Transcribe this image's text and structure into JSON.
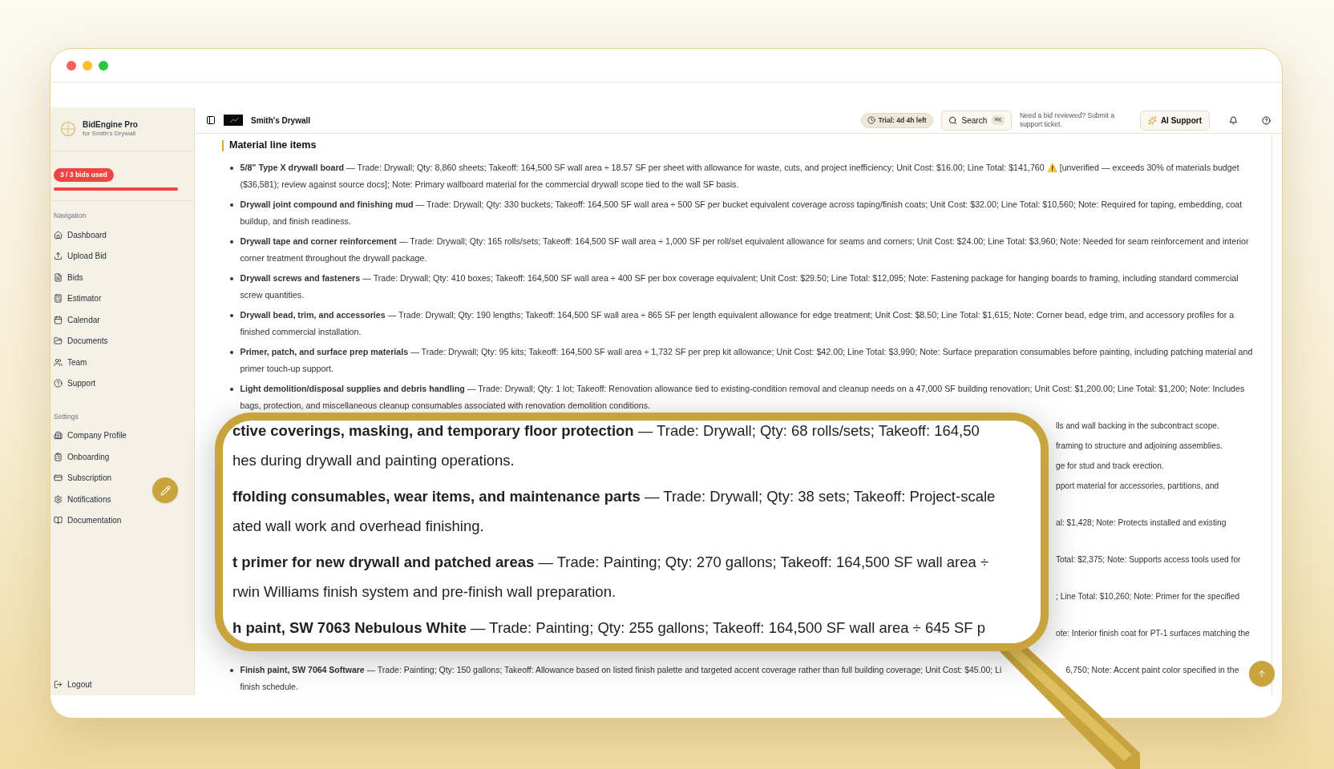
{
  "sidebar": {
    "brand": "BidEngine Pro",
    "subtitle": "for Smith's Drywall",
    "usage": {
      "badge": "3 / 3 bids used",
      "level": 1
    },
    "sections": [
      {
        "title": "Navigation",
        "items": [
          "Dashboard",
          "Upload Bid",
          "Bids",
          "Estimator",
          "Calendar",
          "Documents",
          "Team",
          "Support"
        ]
      },
      {
        "title": "Settings",
        "items": [
          "Company Profile",
          "Onboarding",
          "Subscription",
          "Notifications",
          "Documentation"
        ]
      }
    ],
    "logout": "Logout"
  },
  "header": {
    "company": "Smith's Drywall",
    "trial": "Trial: 4d 4h left",
    "search": "Search",
    "shortcut": "⌘K",
    "help_text": "Need a bid reviewed? Submit a support ticket.",
    "ai_button": "AI Support"
  },
  "section_title": "Material line items",
  "line_items": [
    "**5/8\" Type X drywall board** — Trade: Drywall; Qty: 8,860 sheets; Takeoff: 164,500 SF wall area ÷ 18.57 SF per sheet with allowance for waste, cuts, and project inefficiency; Unit Cost: $16.00; Line Total: $141,760 ⚠️ [unverified — exceeds 30% of materials budget ($36,581); review against source docs]; Note: Primary wallboard material for the commercial drywall scope tied to the wall SF basis.",
    "**Drywall joint compound and finishing mud** — Trade: Drywall; Qty: 330 buckets; Takeoff: 164,500 SF wall area ÷ 500 SF per bucket equivalent coverage across taping/finish coats; Unit Cost: $32.00; Line Total: $10,560; Note: Required for taping, embedding, coat buildup, and finish readiness.",
    "**Drywall tape and corner reinforcement** — Trade: Drywall; Qty: 165 rolls/sets; Takeoff: 164,500 SF wall area ÷ 1,000 SF per roll/set equivalent allowance for seams and corners; Unit Cost: $24.00; Line Total: $3,960; Note: Needed for seam reinforcement and interior corner treatment throughout the drywall package.",
    "**Drywall screws and fasteners** — Trade: Drywall; Qty: 410 boxes; Takeoff: 164,500 SF wall area ÷ 400 SF per box coverage equivalent; Unit Cost: $29.50; Line Total: $12,095; Note: Fastening package for hanging boards to framing, including standard commercial screw quantities.",
    "**Drywall bead, trim, and accessories** — Trade: Drywall; Qty: 190 lengths; Takeoff: 164,500 SF wall area ÷ 865 SF per length equivalent allowance for edge treatment; Unit Cost: $8.50; Line Total: $1,615; Note: Corner bead, edge trim, and accessory profiles for a finished commercial installation.",
    "**Primer, patch, and surface prep materials** — Trade: Drywall; Qty: 95 kits; Takeoff: 164,500 SF wall area ÷ 1,732 SF per prep kit allowance; Unit Cost: $42.00; Line Total: $3,990; Note: Surface preparation consumables before painting, including patching material and primer touch-up support.",
    "**Light demolition/disposal supplies and debris handling** — Trade: Drywall; Qty: 1 lot; Takeoff: Renovation allowance tied to existing-condition removal and cleanup needs on a 47,000 SF building renovation; Unit Cost: $1,200.00; Line Total: $1,200; Note: Includes bags, protection, and miscellaneous cleanup consumables associated with renovation demolition conditions."
  ],
  "covered_rows": [
    {
      "kind": "one_line",
      "text": "lls and wall backing in the subcontract scope."
    },
    {
      "kind": "one_line",
      "text": "framing to structure and adjoining assemblies."
    },
    {
      "kind": "one_line",
      "text": "ge for stud and track erection."
    },
    {
      "kind": "two_line",
      "text": "pport material for accessories, partitions, and"
    },
    {
      "kind": "two_line",
      "text": "al: $1,428; Note: Protects installed and existing"
    },
    {
      "kind": "two_line",
      "text": "Total: $2,375; Note: Supports access tools used for"
    },
    {
      "kind": "two_line",
      "text": "; Line Total: $10,260; Note: Primer for the specified"
    },
    {
      "kind": "two_line",
      "text": "ote: Interior finish coat for PT-1 surfaces matching the"
    }
  ],
  "last_item": {
    "before": "**Finish paint, SW 7064 Software** — Trade: Painting; Qty: 150 gallons; Takeoff: Allowance based on listed finish palette and targeted accent coverage rather than full building coverage; Unit Cost: $45.00; Li",
    "after": "6,750; Note: Accent paint color specified in the",
    "continued": "finish schedule."
  },
  "magnifier": {
    "rows": [
      {
        "first": "**ctive coverings, masking, and temporary floor protection** — Trade: Drywall; Qty: 68 rolls/sets; Takeoff: 164,50",
        "second": "hes during drywall and painting operations."
      },
      {
        "first": "**ffolding consumables, wear items, and maintenance parts** — Trade: Drywall; Qty: 38 sets; Takeoff: Project-scale",
        "second": "ated wall work and overhead finishing."
      },
      {
        "first": "**t primer for new drywall and patched areas** — Trade: Painting; Qty: 270 gallons; Takeoff: 164,500 SF wall area ÷",
        "second": "rwin Williams finish system and pre-finish wall preparation."
      },
      {
        "first": "**h paint, SW 7063 Nebulous White** — Trade: Painting; Qty: 255 gallons; Takeoff: 164,500 SF wall area ÷ 645 SF p"
      }
    ]
  }
}
